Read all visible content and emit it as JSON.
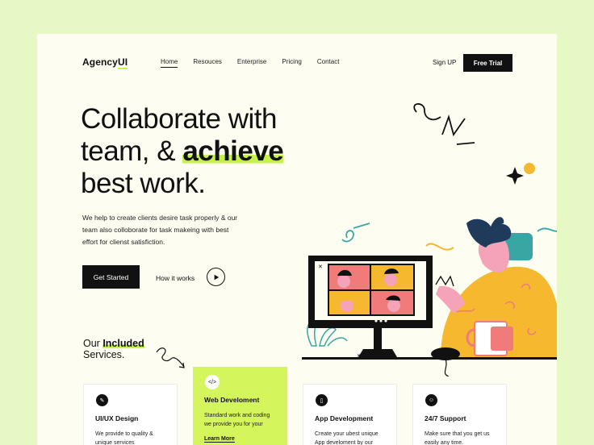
{
  "brand": {
    "name": "AgencyUI",
    "name_main": "Agency",
    "name_accent": "UI"
  },
  "nav": {
    "items": [
      "Home",
      "Resouces",
      "Enterprise",
      "Pricing",
      "Contact"
    ]
  },
  "header": {
    "signup": "Sign UP",
    "trial": "Free Trial"
  },
  "hero": {
    "title_line1": "Collaborate with",
    "title_line2a": "team, & ",
    "title_highlight": "achieve",
    "title_line3": "best work.",
    "description": "We help to create clients desire task properly & our team also colloborate for task makeing with best effort for clienst satisfiction.",
    "cta_primary": "Get Started",
    "cta_secondary": "How it works"
  },
  "services": {
    "title_prefix": "Our ",
    "title_highlight": "Included",
    "title_suffix": "Services.",
    "cards": [
      {
        "title": "UI/UX Design",
        "desc": "We provide to quality & unique services",
        "icon": "pen-tool-icon"
      },
      {
        "title": "Web Develoment",
        "desc": "Standard work and coding we provide you for your",
        "more": "Learn More",
        "icon": "code-icon"
      },
      {
        "title": "App Development",
        "desc": "Create your ubest unique App develoment by our",
        "icon": "phone-icon"
      },
      {
        "title": "24/7 Support",
        "desc": "Make sure that you get us easily any time.",
        "icon": "support-icon"
      }
    ]
  },
  "colors": {
    "accent": "#c8f04a",
    "page_bg": "#e6f9c4",
    "frame_bg": "#fefdf1",
    "dark": "#111111"
  }
}
